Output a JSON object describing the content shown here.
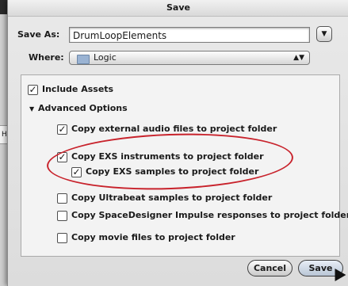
{
  "window": {
    "title": "Save"
  },
  "background": {
    "side_tab_text": "Hy"
  },
  "save_as": {
    "label": "Save As:",
    "value": "DrumLoopElements"
  },
  "where": {
    "label": "Where:",
    "folder_icon": "folder-icon",
    "value": "Logic"
  },
  "options": {
    "include_assets": {
      "label": "Include Assets",
      "checked": true
    },
    "advanced_header": {
      "label": "Advanced Options",
      "expanded": true
    },
    "items": [
      {
        "label": "Copy external audio files to project folder",
        "checked": true
      },
      {
        "label": "Copy EXS instruments to project folder",
        "checked": true
      },
      {
        "label": "Copy EXS samples to project folder",
        "checked": true
      },
      {
        "label": "Copy Ultrabeat samples to project folder",
        "checked": false
      },
      {
        "label": "Copy SpaceDesigner Impulse responses to project folder",
        "checked": false
      },
      {
        "label": "Copy movie files to project folder",
        "checked": false
      }
    ]
  },
  "buttons": {
    "cancel": "Cancel",
    "save": "Save"
  },
  "annotation": {
    "highlight_color": "#c8232c"
  }
}
